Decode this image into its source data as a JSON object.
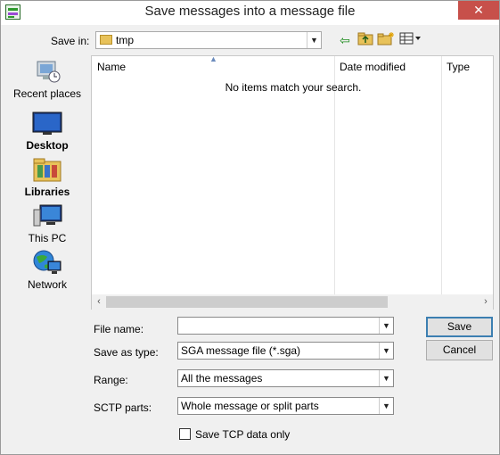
{
  "window": {
    "title": "Save messages into a message file",
    "close_glyph": "✕"
  },
  "save_in": {
    "label": "Save in:",
    "value": "tmp"
  },
  "toolbar": {
    "back_icon": "arrow-left-icon",
    "up_icon": "folder-up-icon",
    "new_folder_icon": "new-folder-icon",
    "view_icon": "view-menu-icon"
  },
  "places": [
    {
      "label": "Recent places",
      "icon": "recent-places-icon"
    },
    {
      "label": "Desktop",
      "icon": "desktop-icon"
    },
    {
      "label": "Libraries",
      "icon": "libraries-icon"
    },
    {
      "label": "This PC",
      "icon": "this-pc-icon"
    },
    {
      "label": "Network",
      "icon": "network-icon"
    }
  ],
  "file_list": {
    "columns": [
      "Name",
      "Date modified",
      "Type"
    ],
    "empty_message": "No items match your search."
  },
  "form": {
    "file_name": {
      "label": "File name:",
      "value": ""
    },
    "save_as_type": {
      "label": "Save as type:",
      "value": "SGA message file (*.sga)"
    },
    "range": {
      "label": "Range:",
      "value": "All the messages"
    },
    "sctp_parts": {
      "label": "SCTP parts:",
      "value": "Whole message or split parts"
    },
    "save_tcp": {
      "label": "Save TCP data only",
      "checked": false
    }
  },
  "buttons": {
    "save": "Save",
    "cancel": "Cancel"
  }
}
